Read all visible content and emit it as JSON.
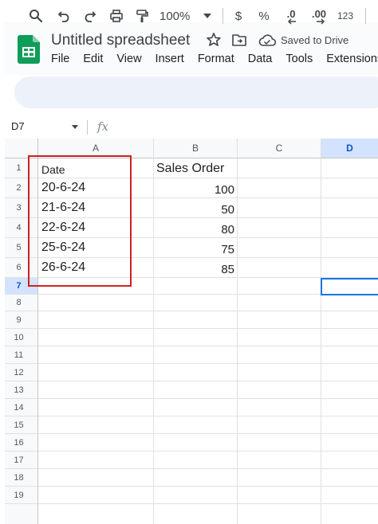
{
  "document": {
    "title": "Untitled spreadsheet",
    "save_status": "Saved to Drive"
  },
  "menu": [
    "File",
    "Edit",
    "View",
    "Insert",
    "Format",
    "Data",
    "Tools",
    "Extensions"
  ],
  "toolbar": {
    "zoom": "100%",
    "currency": "$",
    "percent": "%",
    "decrease_decimal": ".0",
    "increase_decimal": ".00",
    "more_formats": "123"
  },
  "formula_bar": {
    "name_box": "D7",
    "fx_label": "fx"
  },
  "columns": [
    "A",
    "B",
    "C",
    "D"
  ],
  "rows": [
    "1",
    "2",
    "3",
    "4",
    "5",
    "6",
    "7",
    "8",
    "9",
    "10",
    "11",
    "12",
    "13",
    "14",
    "15",
    "16",
    "17",
    "18",
    "19"
  ],
  "cells": {
    "A1": "Date",
    "B1": "Sales Order",
    "A2": "20-6-24",
    "B2": "100",
    "A3": "21-6-24",
    "B3": "50",
    "A4": "22-6-24",
    "B4": "80",
    "A5": "25-6-24",
    "B5": "75",
    "A6": "26-6-24",
    "B6": "85"
  },
  "selected_cell": "D7",
  "colors": {
    "accent": "#1a73e8",
    "highlight_box": "#d21f1f",
    "selected_header": "#d3e3fd",
    "toolbar_bg": "#edf2fa",
    "logo_green": "#0f9d58"
  }
}
